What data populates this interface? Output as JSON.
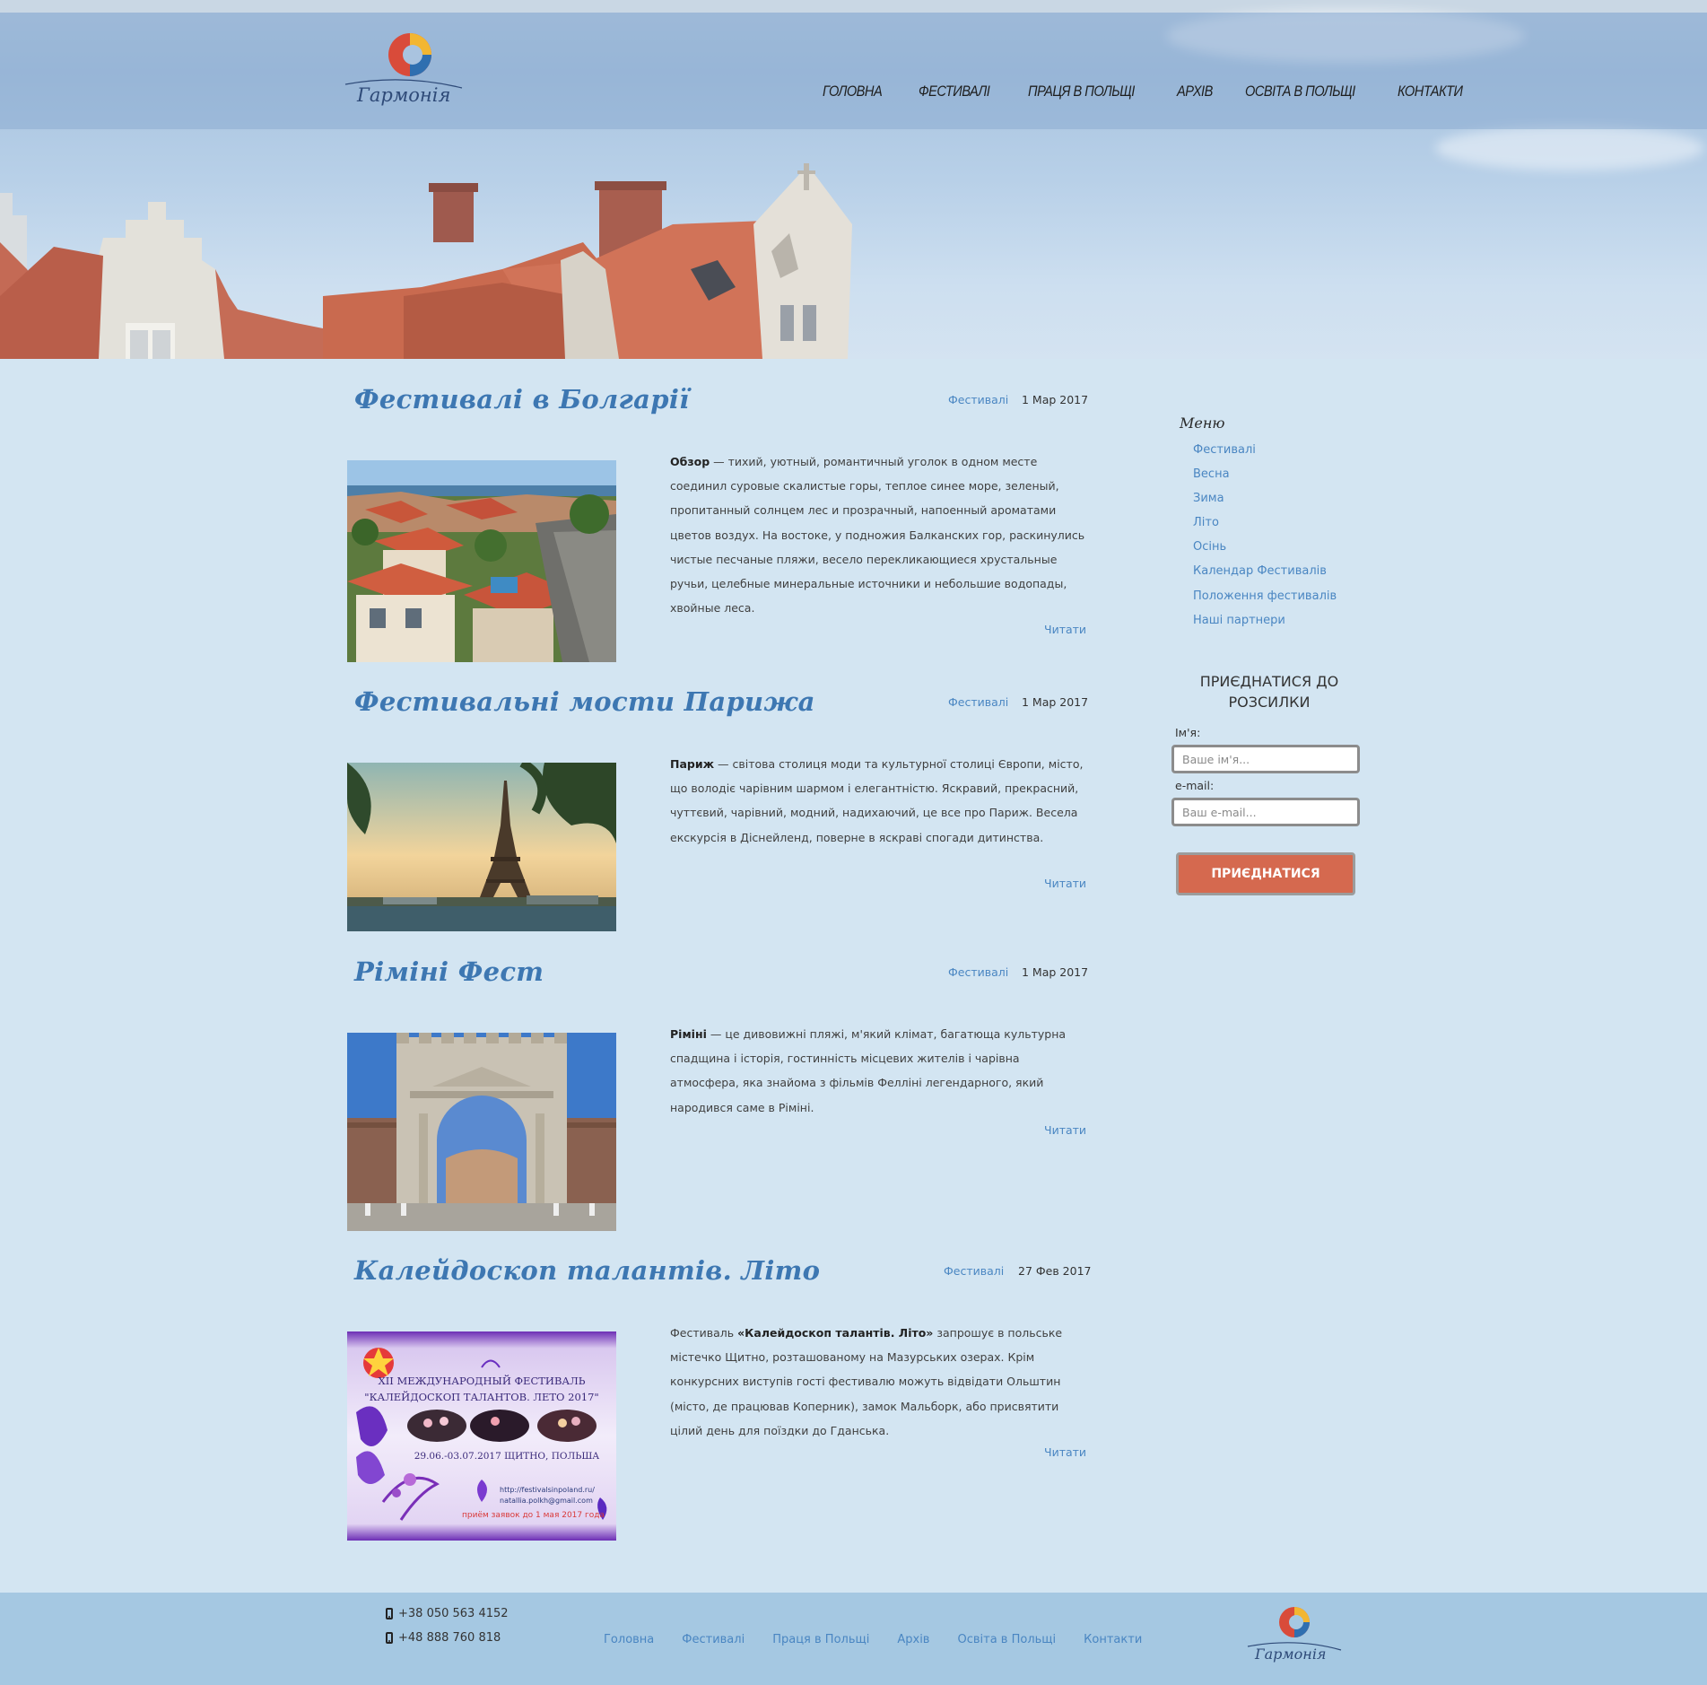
{
  "site": {
    "logo_text": "Гармонія",
    "nav": [
      "Головна",
      "Фестивалі",
      "Праця в Польщі",
      "Архів",
      "Освіта в Польщі",
      "Контакти"
    ]
  },
  "posts": [
    {
      "title": "Фестивалі в Болгарії",
      "category": "Фестивалі",
      "date": "1 Мар 2017",
      "lead": "Обзор",
      "text": " — тихий, уютный, романтичный уголок в одном месте соединил суровые скалистые горы, теплое синее море, зеленый, пропитанный солнцем лес и прозрачный, напоенный ароматами цветов воздух. На востоке, у подножия Балканских гор, раскинулись чистые песчаные пляжи, весело перекликающиеся хрустальные ручьи, целебные минеральные источники и небольшие водопады, хвойные леса.",
      "read_more": "Читати",
      "image": "bulgaria-town-photo"
    },
    {
      "title": "Фестивальні мости Парижа",
      "category": "Фестивалі",
      "date": "1 Мар 2017",
      "lead": "Париж",
      "text": " — світова столиця моди та культурної столиці Європи,  місто, що володіє чарівним шармом і елегантністю. Яскравий, прекрасний, чуттєвий, чарівний, модний, надихаючий, це все про Париж. Весела екскурсія в Діснейленд, поверне в яскраві спогади дитинства.",
      "read_more": "Читати",
      "image": "eiffel-tower-photo"
    },
    {
      "title": "Ріміні Фест",
      "category": "Фестивалі",
      "date": "1 Мар 2017",
      "lead": "Ріміні",
      "text": " — це дивовижні пляжі, м'який клімат, багатюща культурна спадщина і історія, гостинність місцевих жителів і чарівна атмосфера, яка знайома з фільмів Фелліні легендарного, який народився саме в Ріміні.",
      "read_more": "Читати",
      "image": "rimini-arch-photo"
    },
    {
      "title": "Калейдоскоп талантів. Літо",
      "category": "Фестивалі",
      "date": "27 Фев 2017",
      "prefix": "Фестиваль ",
      "lead": "«Калейдоскоп талантів. Літо»",
      "text": " запрошує в польське містечко Щитно, розташованому на Мазурських озерах. Крім конкурсних виступів гості фестивалю можуть відвідати Ольштин (місто, де працював Коперник), замок Мальборк, або присвятити цілий день для поїздки до Гданська.",
      "read_more": "Читати",
      "image": "kaleidoscope-poster",
      "poster": {
        "line1": "XII МЕЖДУНАРОДНЫЙ ФЕСТИВАЛЬ",
        "line2": "\"КАЛЕЙДОСКОП ТАЛАНТОВ. ЛЕТО 2017\"",
        "dates": "29.06.-03.07.2017 ЩИТНО, ПОЛЬША",
        "url": "http://festivalsinpoland.ru/",
        "email": "natallia.polkh@gmail.com",
        "deadline": "приём заявок до 1 мая 2017 года"
      }
    }
  ],
  "sidebar": {
    "menu_title": "Меню",
    "menu": [
      "Фестивалі",
      "Весна",
      "Зима",
      "Літо",
      "Осінь",
      "Календар Фестивалів",
      "Положення фестивалів",
      "Наші партнери"
    ],
    "subscribe": {
      "title": "ПРИЄДНАТИСЯ ДО РОЗСИЛКИ",
      "name_label": "Ім'я:",
      "name_placeholder": "Ваше ім'я...",
      "email_label": "e-mail:",
      "email_placeholder": "Ваш e-mail...",
      "button": "Приєднатися"
    }
  },
  "footer": {
    "phones": [
      "+38 050 563 4152",
      "+48 888 760 818"
    ],
    "nav": [
      "Головна",
      "Фестивалі",
      "Праця в Польщі",
      "Архів",
      "Освіта в Польщі",
      "Контакти"
    ],
    "logo_text": "Гармонія"
  },
  "colors": {
    "page_bg": "#d3e5f2",
    "title_blue": "#3d77b2",
    "link_blue": "#4a86c2",
    "button": "#d5694f",
    "footer_bg": "#a5c8e2"
  }
}
